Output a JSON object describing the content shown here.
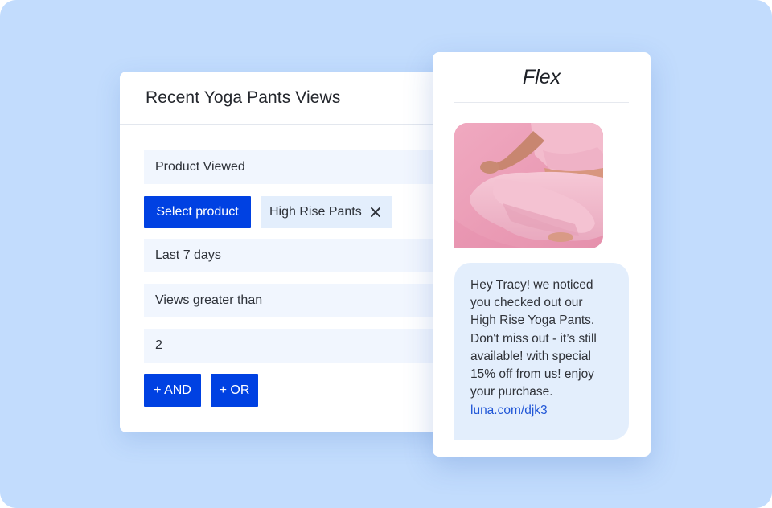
{
  "segment": {
    "title": "Recent Yoga Pants Views",
    "condition_event": "Product Viewed",
    "select_product_label": "Select product",
    "selected_product_chip": "High Rise Pants",
    "time_range": "Last 7 days",
    "operator": "Views greater than",
    "threshold_value": "2",
    "and_button_label": "+ AND",
    "or_button_label": "+ OR"
  },
  "sms_preview": {
    "brand": "Flex",
    "message_body": "Hey Tracy! we noticed\nyou checked out our\nHigh Rise Yoga Pants.\nDon't miss out - it’s still\navailable! with special\n15% off from us! enjoy\nyour purchase.",
    "link_text": "luna.com/djk3"
  },
  "colors": {
    "background": "#c2dcfd",
    "primary_button": "#0041e2",
    "field_bg": "#f1f6fe",
    "chip_bg": "#e3eefc",
    "link": "#1f55d6"
  },
  "icons": {
    "chip_remove": "close-icon",
    "product_photo": "yoga-pose-image"
  }
}
